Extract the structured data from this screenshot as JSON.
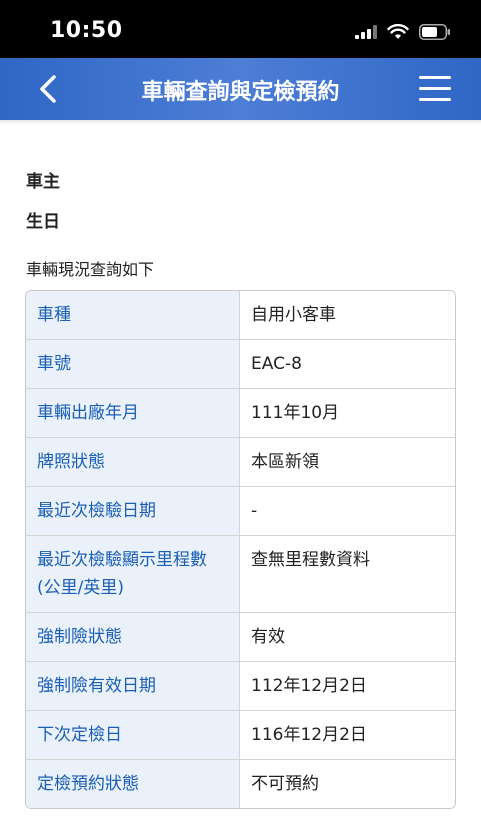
{
  "status_bar": {
    "time": "10:50"
  },
  "header": {
    "title": "車輛查詢與定檢預約",
    "back_icon": "chevron-left-icon",
    "menu_icon": "hamburger-menu-icon",
    "background_color": "#3a6fcc"
  },
  "owner": {
    "label": "車主"
  },
  "birth": {
    "label": "生日"
  },
  "intro": "車輛現況查詢如下",
  "table": {
    "rows": [
      {
        "label": "車種",
        "value": "自用小客車"
      },
      {
        "label": "車號",
        "value": "EAC-8"
      },
      {
        "label": "車輛出廠年月",
        "value": "111年10月"
      },
      {
        "label": "牌照狀態",
        "value": "本區新領"
      },
      {
        "label": "最近次檢驗日期",
        "value": "-"
      },
      {
        "label": "最近次檢驗顯示里程數(公里/英里)",
        "value": "查無里程數資料"
      },
      {
        "label": "強制險狀態",
        "value": "有效"
      },
      {
        "label": "強制險有效日期",
        "value": "112年12月2日"
      },
      {
        "label": "下次定檢日",
        "value": "116年12月2日"
      },
      {
        "label": "定檢預約狀態",
        "value": "不可預約"
      }
    ]
  }
}
